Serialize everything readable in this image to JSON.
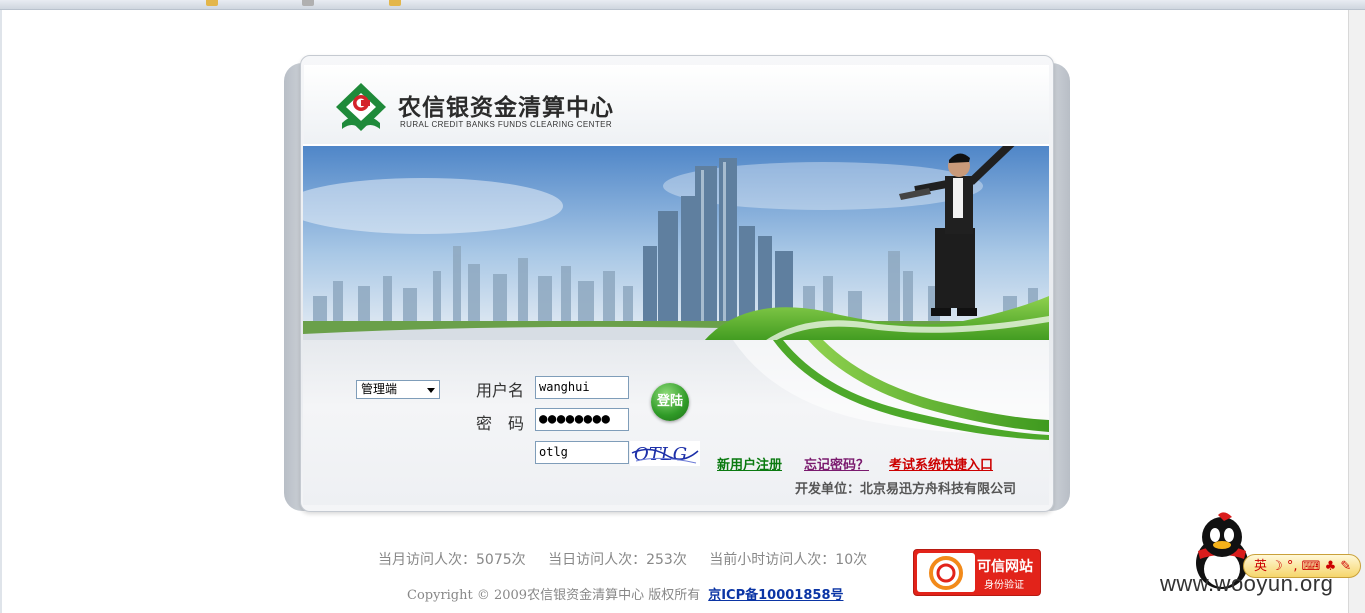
{
  "header": {
    "title_cn": "农信银资金清算中心",
    "title_en": "RURAL CREDIT BANKS FUNDS CLEARING CENTER"
  },
  "login": {
    "role_value": "管理端",
    "username_label": "用户名",
    "username_value": "wanghui",
    "password_label": "密　码",
    "password_value": "●●●●●●●●",
    "captcha_value": "otlg",
    "captcha_image_text": "OTLG",
    "login_button": "登陆"
  },
  "links": {
    "register": "新用户注册",
    "forgot_password": "忘记密码？",
    "exam_entry": "考试系统快捷入口"
  },
  "developer": "开发单位：北京易迅方舟科技有限公司",
  "footer": {
    "monthly_visits": "当月访问人次：5075次",
    "daily_visits": "当日访问人次：253次",
    "hourly_visits": "当前小时访问人次：10次",
    "copyright": "Copyright © 2009农信银资金清算中心 版权所有",
    "icp": "京ICP备10001858号"
  },
  "trust_badge": {
    "title": "可信网站",
    "subtitle": "身份验证"
  },
  "ime_toolbar": "英 ☽ °, ⌨ ♣ ✎",
  "watermark": "www.wooyun.org",
  "colors": {
    "register_link": "#0a7a10",
    "forgot_link": "#7a1a6e",
    "exam_link": "#cc0000",
    "icp_link": "#0b35a5",
    "logo_green": "#1f8a3a",
    "logo_red": "#d4232a"
  }
}
